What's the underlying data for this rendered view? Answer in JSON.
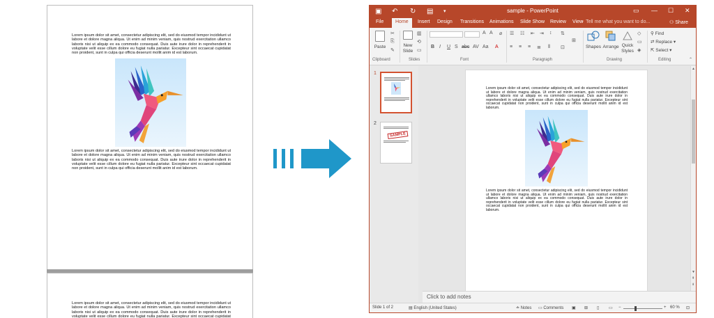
{
  "document": {
    "paragraph": "Lorem ipsum dolor sit amet, consectetur adipiscing elit, sed do eiusmod tempor incididunt ut labore et dolore magna aliqua. Ut enim ad minim veniam, quis nostrud exercitation ullamco laboris nisi ut aliquip ex ea commodo consequat. Duis aute irure dolor in reprehenderit in voluptate velit esse cillum dolore eu fugiat nulla pariatur. Excepteur sint occaecat cupidatat non proident, sunt in culpa qui officia deserunt mollit anim id est laborum."
  },
  "powerpoint": {
    "window_title": "sample - PowerPoint",
    "tabs": [
      "File",
      "Home",
      "Insert",
      "Design",
      "Transitions",
      "Animations",
      "Slide Show",
      "Review",
      "View"
    ],
    "active_tab": "Home",
    "tell_me": "Tell me what you want to do...",
    "share": "Share",
    "ribbon": {
      "paste": "Paste",
      "new_slide": "New Slide",
      "shapes": "Shapes",
      "arrange": "Arrange",
      "quick_styles": "Quick Styles",
      "find": "Find",
      "replace": "Replace",
      "select": "Select",
      "group_clipboard": "Clipboard",
      "group_slides": "Slides",
      "group_font": "Font",
      "group_paragraph": "Paragraph",
      "group_drawing": "Drawing",
      "group_editing": "Editing"
    },
    "thumbnails": [
      {
        "number": "1"
      },
      {
        "number": "2",
        "stamp": "SAMPLE"
      }
    ],
    "notes_placeholder": "Click to add notes",
    "status": {
      "slide_info": "Slide 1 of 2",
      "language": "English (United States)",
      "notes": "Notes",
      "comments": "Comments",
      "zoom": "60 %"
    }
  },
  "colors": {
    "accent": "#b7472a",
    "arrow": "#1f97c9"
  }
}
